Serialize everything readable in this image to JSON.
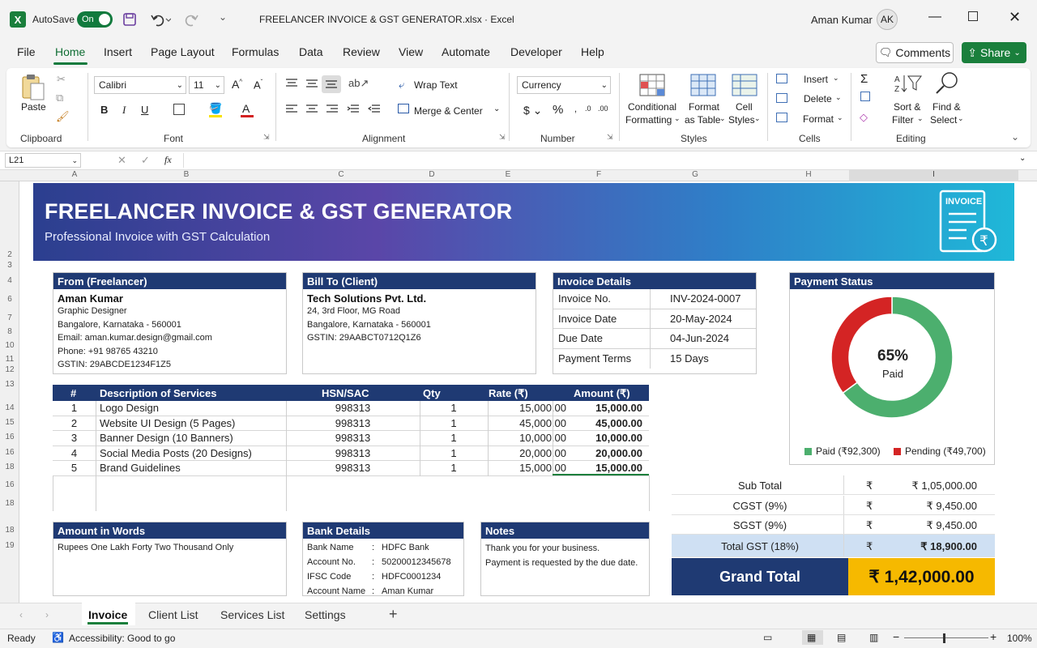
{
  "window": {
    "autosave_label": "AutoSave",
    "autosave_state": "On",
    "title": "FREELANCER INVOICE & GST GENERATOR.xlsx  ·  Excel",
    "user_name": "Aman Kumar",
    "user_initials": "AK"
  },
  "menu": {
    "items": [
      "File",
      "Home",
      "Insert",
      "Page Layout",
      "Formulas",
      "Data",
      "Review",
      "View",
      "Automate",
      "Developer",
      "Help"
    ],
    "comments": "Comments",
    "share": "Share"
  },
  "ribbon": {
    "paste": "Paste",
    "clipboard": "Clipboard",
    "font_name": "Calibri",
    "font_size": "11",
    "font": "Font",
    "wrap_text": "Wrap Text",
    "merge_center": "Merge & Center",
    "alignment": "Alignment",
    "number_format": "Currency",
    "number": "Number",
    "cond_format_1": "Conditional",
    "cond_format_2": "Formatting",
    "format_table_1": "Format",
    "format_table_2": "as Table",
    "cell_styles_1": "Cell",
    "cell_styles_2": "Styles",
    "styles": "Styles",
    "insert": "Insert",
    "delete": "Delete",
    "format": "Format",
    "cells": "Cells",
    "sort_filter_1": "Sort &",
    "sort_filter_2": "Filter",
    "find_select_1": "Find &",
    "find_select_2": "Select",
    "editing": "Editing"
  },
  "formula_bar": {
    "name_box": "L21",
    "fx": "fx"
  },
  "columns": [
    "A",
    "B",
    "C",
    "D",
    "E",
    "F",
    "G",
    "H",
    "I"
  ],
  "rows": [
    "2",
    "3",
    "4",
    "6",
    "7",
    "8",
    "10",
    "11",
    "12",
    "13",
    "14",
    "15",
    "16",
    "16",
    "18",
    "16",
    "18",
    "18",
    "19"
  ],
  "banner": {
    "title": "FREELANCER INVOICE & GST GENERATOR",
    "subtitle": "Professional Invoice with GST Calculation",
    "icon_label": "INVOICE"
  },
  "from": {
    "header": "From (Freelancer)",
    "name": "Aman Kumar",
    "lines": [
      "Graphic Designer",
      "Bangalore, Karnataka - 560001",
      "Email: aman.kumar.design@gmail.com",
      "Phone: +91 98765 43210",
      "GSTIN: 29ABCDE1234F1Z5"
    ]
  },
  "bill_to": {
    "header": "Bill To (Client)",
    "name": "Tech Solutions Pvt. Ltd.",
    "lines": [
      "24, 3rd Floor, MG Road",
      "Bangalore, Karnataka - 560001",
      "GSTIN: 29AABCT0712Q1Z6"
    ]
  },
  "invoice_details": {
    "header": "Invoice Details",
    "rows": [
      {
        "k": "Invoice No.",
        "v": "INV-2024-0007"
      },
      {
        "k": "Invoice Date",
        "v": "20-May-2024"
      },
      {
        "k": "Due Date",
        "v": "04-Jun-2024"
      },
      {
        "k": "Payment Terms",
        "v": "15 Days"
      }
    ]
  },
  "payment_status": {
    "header": "Payment Status",
    "percent_label": "65%",
    "paid_word": "Paid",
    "legend_paid": "Paid (₹92,300)",
    "legend_pending": "Pending (₹49,700)",
    "colors": {
      "paid": "#4caf6e",
      "pending": "#d42424"
    }
  },
  "chart_data": {
    "type": "pie",
    "categories": [
      "Paid",
      "Pending"
    ],
    "values": [
      65,
      35
    ],
    "title": "Payment Status"
  },
  "items": {
    "headers": [
      "#",
      "Description of Services",
      "HSN/SAC",
      "Qty",
      "Rate (₹)",
      "Amount (₹)"
    ],
    "rows": [
      [
        "1",
        "Logo Design",
        "998313",
        "1",
        "15,000.00",
        "15,000.00"
      ],
      [
        "2",
        "Website UI Design (5 Pages)",
        "998313",
        "1",
        "45,000.00",
        "45,000.00"
      ],
      [
        "3",
        "Banner Design (10 Banners)",
        "998313",
        "1",
        "10,000.00",
        "10,000.00"
      ],
      [
        "4",
        "Social Media Posts (20 Designs)",
        "998313",
        "1",
        "20,000.00",
        "20,000.00"
      ],
      [
        "5",
        "Brand Guidelines",
        "998313",
        "1",
        "15,000.00",
        "15,000.00"
      ]
    ]
  },
  "totals": {
    "rows": [
      {
        "label": "Sub Total",
        "sym": "₹",
        "value": "₹ 1,05,000.00"
      },
      {
        "label": "CGST (9%)",
        "sym": "₹",
        "value": "₹ 9,450.00"
      },
      {
        "label": "SGST (9%)",
        "sym": "₹",
        "value": "₹ 9,450.00"
      },
      {
        "label": "Total GST (18%)",
        "sym": "₹",
        "value": "₹ 18,900.00"
      }
    ],
    "grand_label": "Grand Total",
    "grand_value": "₹ 1,42,000.00"
  },
  "words": {
    "header": "Amount in Words",
    "text": "Rupees One Lakh Forty Two Thousand Only"
  },
  "bank": {
    "header": "Bank Details",
    "rows": [
      {
        "k": "Bank Name",
        "v": "HDFC Bank"
      },
      {
        "k": "Account No.",
        "v": "50200012345678"
      },
      {
        "k": "IFSC Code",
        "v": "HDFC0001234"
      },
      {
        "k": "Account Name",
        "v": "Aman Kumar"
      }
    ]
  },
  "notes": {
    "header": "Notes",
    "lines": [
      "Thank you for your business.",
      "Payment is requested by the due date."
    ]
  },
  "sheets": {
    "tabs": [
      "Invoice",
      "Client List",
      "Services List",
      "Settings"
    ],
    "add": "+"
  },
  "status": {
    "ready": "Ready",
    "accessibility": "Accessibility: Good to go",
    "zoom": "100%"
  }
}
